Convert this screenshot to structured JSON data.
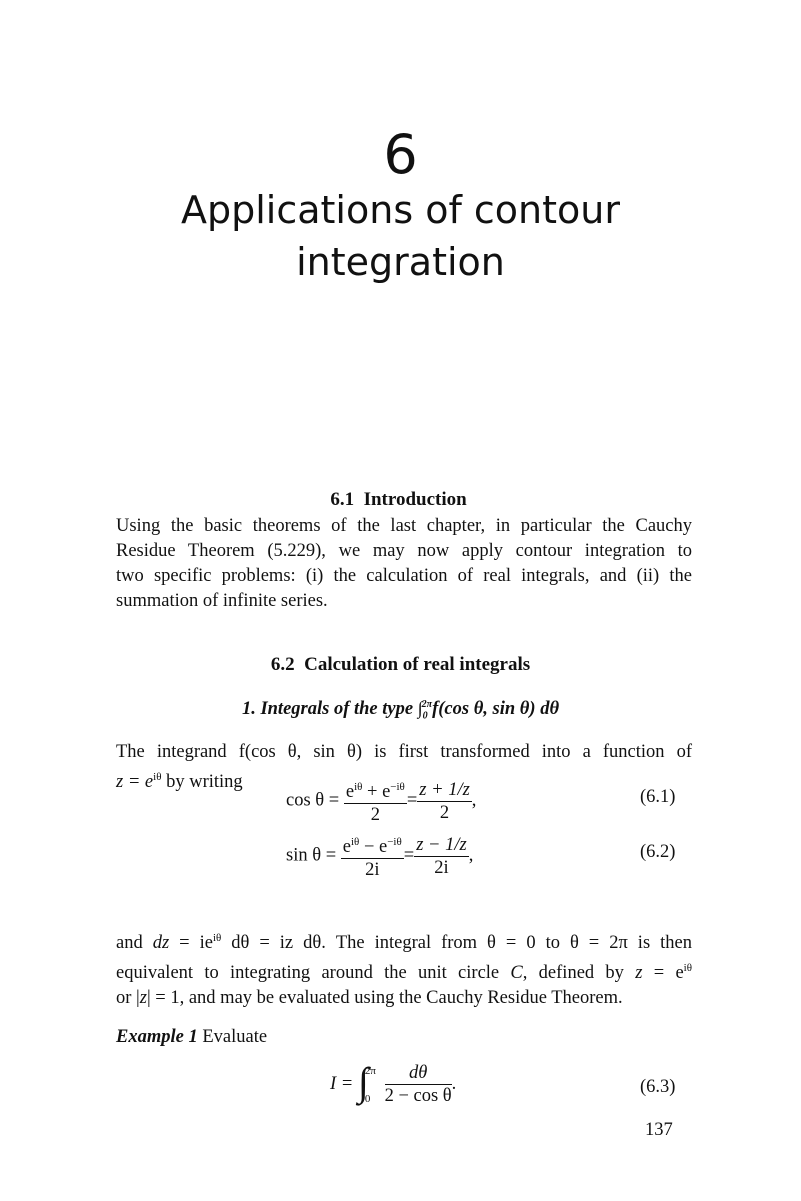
{
  "chapter": {
    "number": "6",
    "title_line1": "Applications of contour",
    "title_line2": "integration"
  },
  "sections": [
    {
      "heading": "6.1  Introduction",
      "paragraph_lines": [
        "Using the basic theorems of the last chapter, in particular the Cauchy",
        "Residue Theorem (5.229), we may now apply contour integration to",
        "two specific problems: (i) the calculation of real integrals, and (ii) the",
        "summation of infinite series."
      ]
    },
    {
      "heading": "6.2  Calculation of real integrals",
      "subsection": {
        "label": "1. Integrals of the type ",
        "integral_sign": "∫",
        "upper_limit": "2π",
        "lower_limit": "0",
        "integrand": "f(cos θ, sin θ) dθ"
      },
      "integrand_para": {
        "line1": "The integrand f(cos θ, sin θ) is first transformed into a function of",
        "line2_prefix": "z = e",
        "line2_sup": "iθ",
        "line2_suffix": " by writing"
      }
    }
  ],
  "equations": [
    {
      "lhs": "cos θ =",
      "frac1_num": "e^{iθ} + e^{−iθ}",
      "frac1_num_parts": [
        "e",
        "iθ",
        " + e",
        "−iθ"
      ],
      "frac1_den": "2",
      "frac2_num": "z + 1/z",
      "frac2_den": "2",
      "trail": ",",
      "number": "(6.1)"
    },
    {
      "lhs": "sin θ =",
      "frac1_num_parts": [
        "e",
        "iθ",
        " − e",
        "−iθ"
      ],
      "frac1_den": "2i",
      "frac2_num": "z − 1/z",
      "frac2_den": "2i",
      "trail": ",",
      "number": "(6.2)"
    },
    {
      "lhs": "I =",
      "upper_limit": "2π",
      "lower_limit": "0",
      "frac_num": "dθ",
      "frac_den": "2 − cos θ",
      "trail": ".",
      "number": "(6.3)"
    }
  ],
  "contour_para_lines": [
    "and dz = ie^{iθ} dθ = iz dθ. The integral from θ = 0 to θ = 2π is then",
    "equivalent to integrating around the unit circle C, defined by z = e^{iθ}",
    "or |z| = 1, and may be evaluated using the Cauchy Residue Theorem."
  ],
  "contour_para": {
    "l1_a": "and ",
    "l1_dz": "dz",
    "l1_b": " = ie",
    "l1_sup": "iθ",
    "l1_c": " dθ = iz dθ. The integral from θ = 0 to θ = 2π is then",
    "l2_a": "equivalent to integrating around the unit circle ",
    "l2_C": "C",
    "l2_b": ", defined by ",
    "l2_z": "z",
    "l2_c": " = e",
    "l2_sup": "iθ",
    "l3_a": "or |",
    "l3_z": "z",
    "l3_b": "| = 1, and may be evaluated using the Cauchy Residue Theorem."
  },
  "example": {
    "label": "Example 1",
    "text": " Evaluate"
  },
  "page_number": "137"
}
